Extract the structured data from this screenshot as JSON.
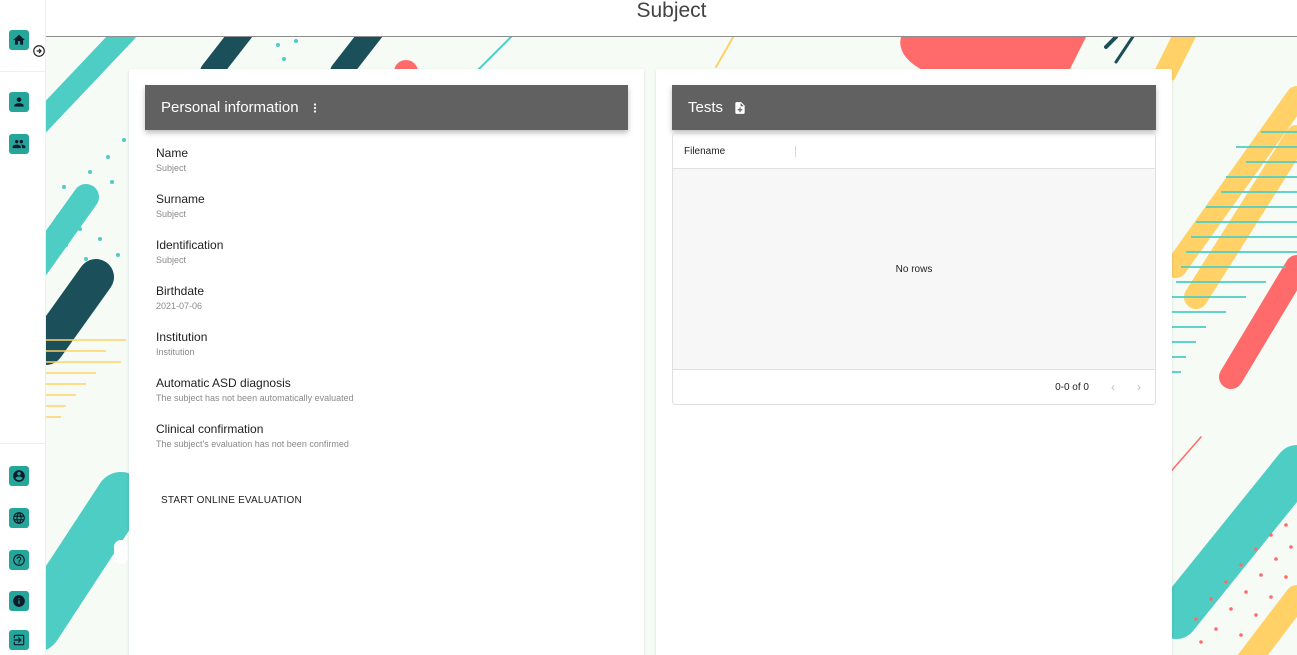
{
  "header": {
    "title": "Subject"
  },
  "sidebar": {
    "top_items": [
      {
        "icon": "home-icon"
      },
      {
        "icon": "person-icon"
      },
      {
        "icon": "people-icon"
      }
    ],
    "expand_icon": "arrow-circle-right-icon",
    "bottom_items": [
      {
        "icon": "account-circle-icon"
      },
      {
        "icon": "globe-icon"
      },
      {
        "icon": "help-icon"
      },
      {
        "icon": "info-icon"
      },
      {
        "icon": "logout-icon"
      }
    ]
  },
  "personal": {
    "title": "Personal information",
    "menu_icon": "more-vertical-icon",
    "fields": [
      {
        "label": "Name",
        "value": "Subject"
      },
      {
        "label": "Surname",
        "value": "Subject"
      },
      {
        "label": "Identification",
        "value": "Subject"
      },
      {
        "label": "Birthdate",
        "value": "2021-07-06"
      },
      {
        "label": "Institution",
        "value": "Institution"
      },
      {
        "label": "Automatic ASD diagnosis",
        "value": "The subject has not been automatically evaluated"
      },
      {
        "label": "Clinical confirmation",
        "value": "The subject's evaluation has not been confirmed"
      }
    ],
    "start_button": "START ONLINE EVALUATION"
  },
  "tests": {
    "title": "Tests",
    "add_icon": "file-add-icon",
    "columns": [
      "Filename"
    ],
    "empty_text": "No rows",
    "pagination": "0-0 of 0"
  },
  "colors": {
    "header_bar": "#616161",
    "accent_teal": "#4ecdc4",
    "accent_dark": "#1b4f5a",
    "accent_red": "#ff6b6b",
    "accent_yellow": "#ffd166",
    "sidebar_button": "#26a69a"
  }
}
